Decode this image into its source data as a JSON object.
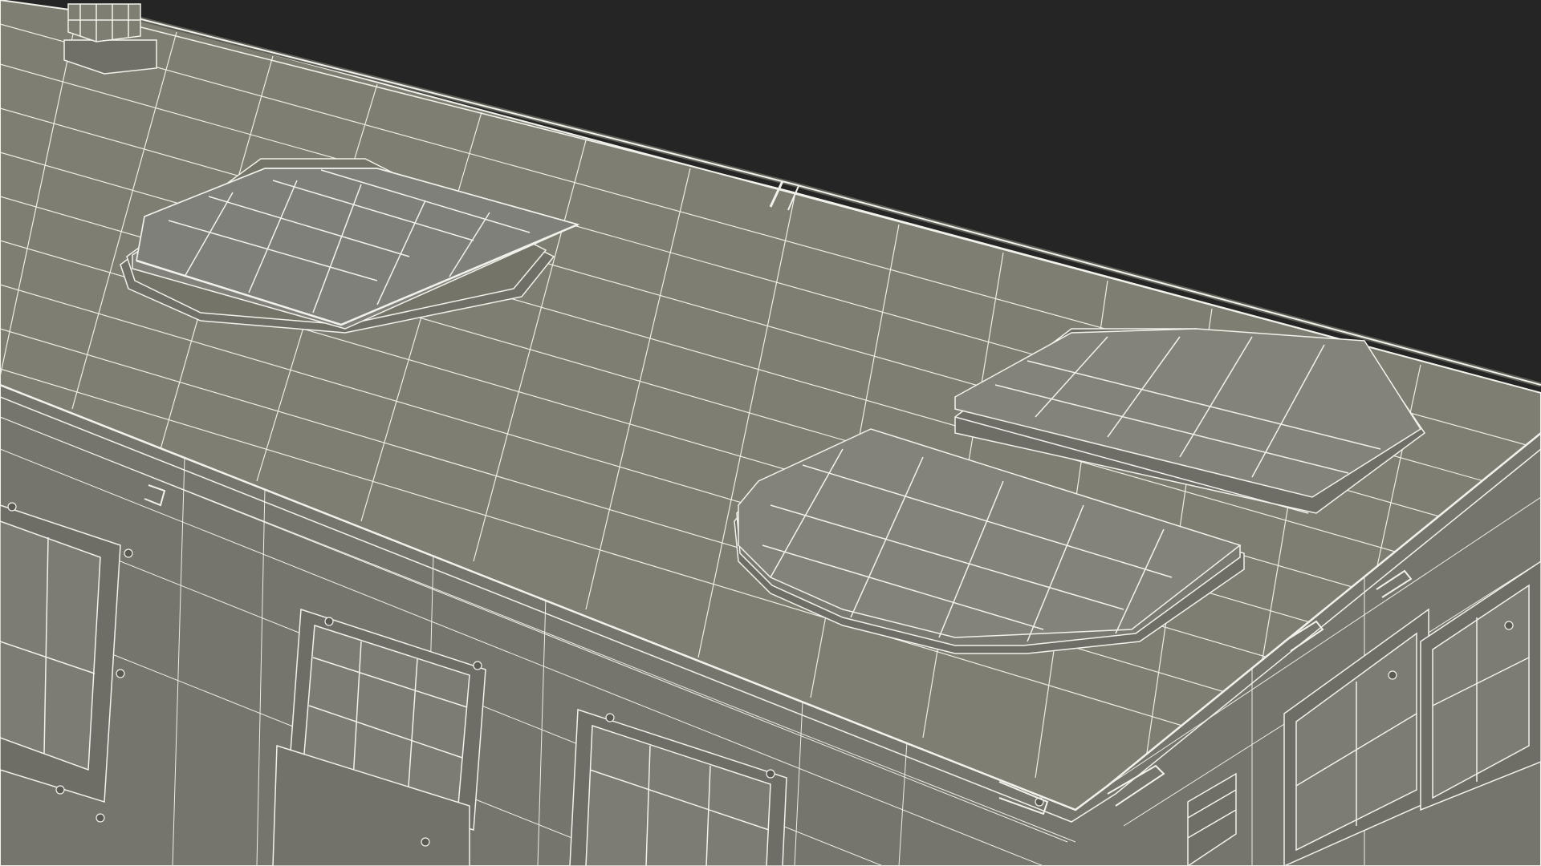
{
  "scene": {
    "subject": "armored-vehicle-roof-wireframe",
    "render_style": "grey clay with white wireframe overlay",
    "colors": {
      "background": "#252525",
      "surface": "#7d7d72",
      "surface_dark": "#6b6b62",
      "surface_light": "#8a8a7f",
      "wire": "#f2f2ec",
      "edge": "#2b2b28"
    }
  }
}
